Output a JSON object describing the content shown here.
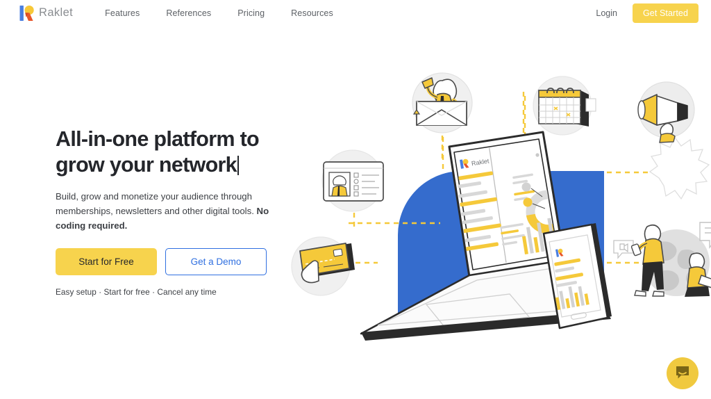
{
  "header": {
    "brand": {
      "name": "Raklet",
      "logo_icon": "raklet-r-logo-icon"
    },
    "nav": [
      {
        "label": "Features"
      },
      {
        "label": "References"
      },
      {
        "label": "Pricing"
      },
      {
        "label": "Resources"
      }
    ],
    "login_label": "Login",
    "get_started_label": "Get Started"
  },
  "hero": {
    "headline_line1": "All-in-one platform to",
    "headline_line2": "grow your  network",
    "subcopy_normal": "Build, grow and monetize your audience through memberships, newsletters and other digital tools. ",
    "subcopy_bold": "No coding required.",
    "primary_cta": "Start for Free",
    "secondary_cta": "Get a Demo",
    "trust_line": "Easy setup · Start for free · Cancel any time",
    "illustration": {
      "dashboard_brand": "Raklet",
      "elements": [
        "envelope-megaphone-icon",
        "calendar-icon",
        "profile-card-icon",
        "credit-card-icon",
        "megaphone-icon",
        "people-globe-icon",
        "laptop-dashboard",
        "tablet-dashboard"
      ]
    }
  },
  "chat": {
    "icon": "chat-bubble-icon"
  },
  "colors": {
    "brand_yellow": "#f7d34d",
    "brand_blue": "#2f6fe0",
    "illustration_blue": "#356ccd",
    "logo_blue": "#4a7fe0",
    "logo_yellow": "#f7c838",
    "logo_red": "#e8562a",
    "text_dark": "#24262b",
    "text_muted": "#5d6166",
    "chat_yellow": "#f0c93f",
    "line_gray": "#3a3a3a",
    "fill_gray": "#e3e3e3",
    "page_bg": "#ffffff"
  }
}
